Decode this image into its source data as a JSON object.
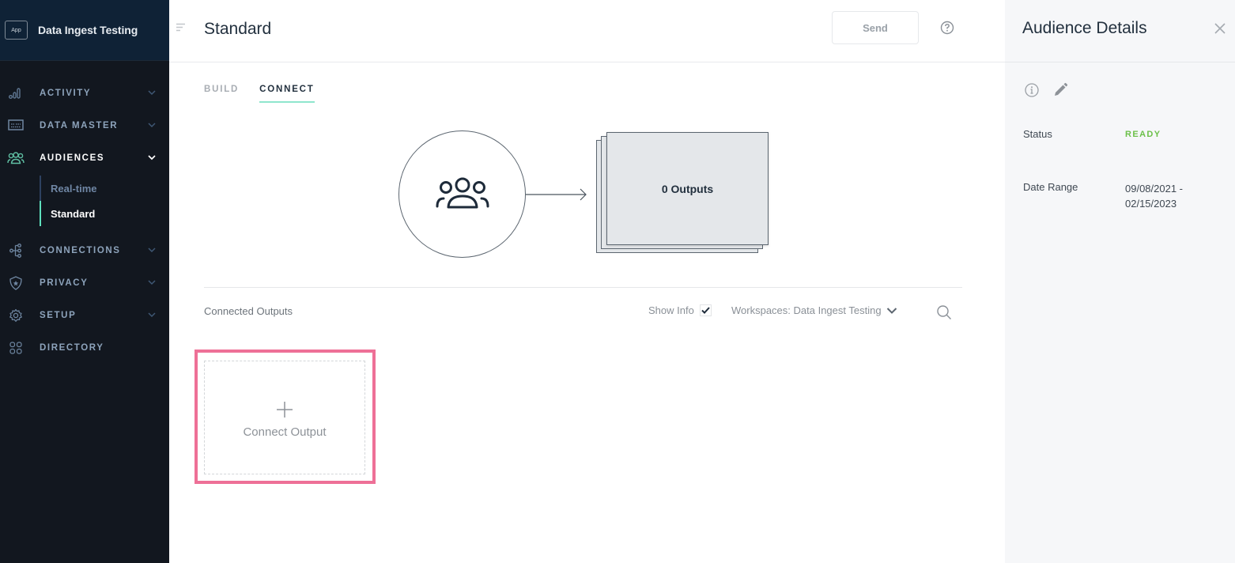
{
  "sidebar": {
    "app_badge": "App",
    "workspace_name": "Data Ingest Testing",
    "items": [
      {
        "label": "ACTIVITY",
        "icon": "bar-chart-icon",
        "expandable": true,
        "active": false
      },
      {
        "label": "DATA MASTER",
        "icon": "data-table-icon",
        "expandable": true,
        "active": false
      },
      {
        "label": "AUDIENCES",
        "icon": "users-icon",
        "expandable": true,
        "active": true,
        "children": [
          {
            "label": "Real-time",
            "active": false
          },
          {
            "label": "Standard",
            "active": true
          }
        ]
      },
      {
        "label": "CONNECTIONS",
        "icon": "connections-tree-icon",
        "expandable": true,
        "active": false
      },
      {
        "label": "PRIVACY",
        "icon": "shield-star-icon",
        "expandable": true,
        "active": false
      },
      {
        "label": "SETUP",
        "icon": "gear-icon",
        "expandable": true,
        "active": false
      },
      {
        "label": "DIRECTORY",
        "icon": "grid-icon",
        "expandable": false,
        "active": false
      }
    ]
  },
  "header": {
    "title": "Standard",
    "send_label": "Send",
    "help_icon": "question-circle-icon"
  },
  "tabs": [
    {
      "label": "BUILD",
      "active": false
    },
    {
      "label": "CONNECT",
      "active": true
    }
  ],
  "diagram": {
    "source_icon": "users-icon",
    "outputs_label": "0 Outputs"
  },
  "connected_outputs": {
    "section_label": "Connected Outputs",
    "show_info_label": "Show Info",
    "show_info_checked": true,
    "workspace_filter": "Workspaces: Data Ingest Testing",
    "connect_output_label": "Connect Output"
  },
  "details_panel": {
    "title": "Audience Details",
    "status_label": "Status",
    "status_value": "READY",
    "date_range_label": "Date Range",
    "date_range_start": "09/08/2021 -",
    "date_range_end": "02/15/2023"
  },
  "colors": {
    "sidebar_bg": "#12171f",
    "accent_teal": "#5ee0bd",
    "highlight_pink": "#ee7097",
    "status_ready": "#6cc04a"
  }
}
